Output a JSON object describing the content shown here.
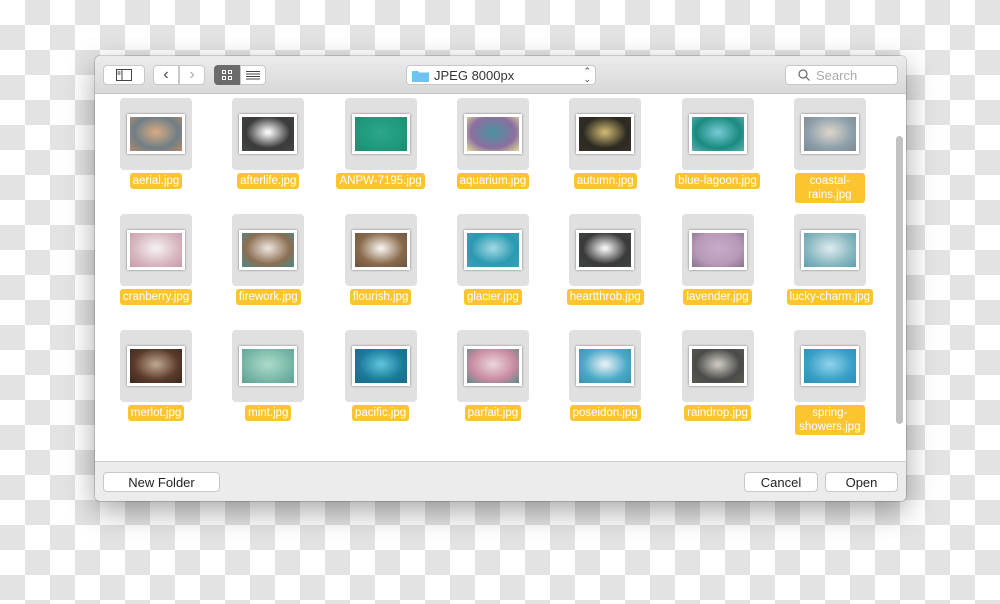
{
  "toolbar": {
    "path": "JPEG 8000px",
    "search_placeholder": "Search",
    "folder_color": "#6ec3f0"
  },
  "footer": {
    "new_folder": "New Folder",
    "cancel": "Cancel",
    "open": "Open"
  },
  "files": [
    {
      "name": "aerial.jpg",
      "colors": [
        "#6f7e86",
        "#d0a884",
        "#b58a66"
      ]
    },
    {
      "name": "afterlife.jpg",
      "colors": [
        "#3a3a3a",
        "#f4f4f4",
        "#404848"
      ]
    },
    {
      "name": "ANPW-7195.jpg",
      "colors": [
        "#1f9a7c",
        "#2ca58b",
        "#1e8a6e"
      ]
    },
    {
      "name": "aquarium.jpg",
      "colors": [
        "#8c6fa0",
        "#4d8f9e",
        "#e6dc94"
      ]
    },
    {
      "name": "autumn.jpg",
      "colors": [
        "#2b2a22",
        "#c8b26e",
        "#3a2f25"
      ]
    },
    {
      "name": "blue-lagoon.jpg",
      "colors": [
        "#1b8a7e",
        "#6fc6d0",
        "#5fb0b4"
      ]
    },
    {
      "name": "coastal-rains.jpg",
      "colors": [
        "#8ea0ac",
        "#d8d2c8",
        "#7c8a90"
      ]
    },
    {
      "name": "cranberry.jpg",
      "colors": [
        "#d8b8c0",
        "#f4eef0",
        "#c89aa8"
      ]
    },
    {
      "name": "firework.jpg",
      "colors": [
        "#8a6e52",
        "#e8ddd4",
        "#4a8a8a"
      ]
    },
    {
      "name": "flourish.jpg",
      "colors": [
        "#8a6a4c",
        "#f2ede6",
        "#6a5240"
      ]
    },
    {
      "name": "glacier.jpg",
      "colors": [
        "#2a9ab0",
        "#9ad4e0",
        "#3aa0b8"
      ]
    },
    {
      "name": "heartthrob.jpg",
      "colors": [
        "#3a3a3a",
        "#f0f0f0",
        "#3e4646"
      ]
    },
    {
      "name": "lavender.jpg",
      "colors": [
        "#b89ab8",
        "#c8a8c8",
        "#8a7090"
      ]
    },
    {
      "name": "lucky-charm.jpg",
      "colors": [
        "#8ab8c0",
        "#d8e8ec",
        "#5aa0b0"
      ]
    },
    {
      "name": "merlot.jpg",
      "colors": [
        "#5a3a2a",
        "#b8a08a",
        "#3a2820"
      ]
    },
    {
      "name": "mint.jpg",
      "colors": [
        "#7ab8a8",
        "#a8d8c8",
        "#5aa090"
      ]
    },
    {
      "name": "pacific.jpg",
      "colors": [
        "#1a7a9a",
        "#5ac0d8",
        "#1a6a8a"
      ]
    },
    {
      "name": "parfait.jpg",
      "colors": [
        "#c88aa0",
        "#e8d0d8",
        "#5a8a8a"
      ]
    },
    {
      "name": "poseidon.jpg",
      "colors": [
        "#4aa8c8",
        "#e0eef2",
        "#3a90b0"
      ]
    },
    {
      "name": "raindrop.jpg",
      "colors": [
        "#4a4a48",
        "#c8c4bc",
        "#5a5a52"
      ]
    },
    {
      "name": "spring-showers.jpg",
      "colors": [
        "#3aa0c8",
        "#8ad0e8",
        "#2a90b8"
      ]
    }
  ]
}
